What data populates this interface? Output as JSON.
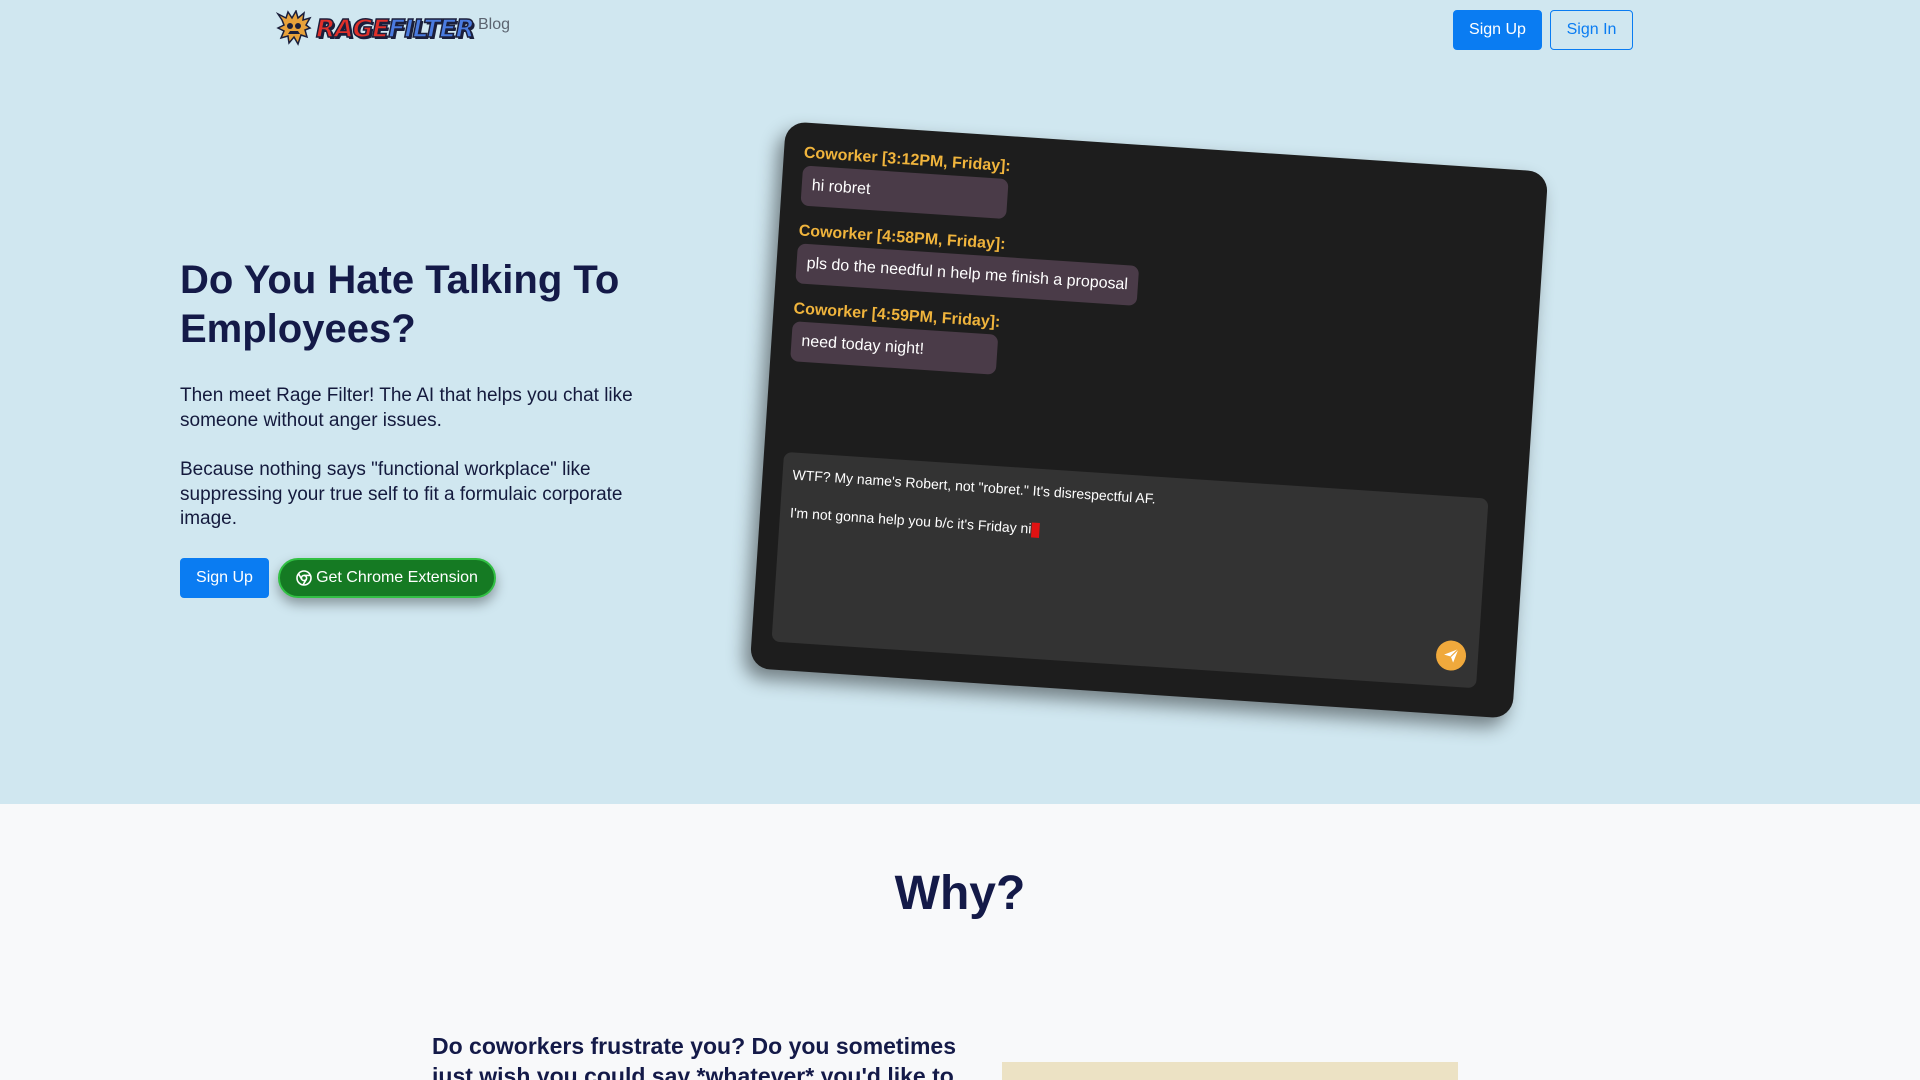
{
  "nav": {
    "brand": {
      "part1": "RAGE",
      "part2": "FILTER"
    },
    "blog_label": "Blog",
    "signup_label": "Sign Up",
    "signin_label": "Sign In"
  },
  "hero": {
    "title": "Do You Hate Talking To Employees?",
    "paragraph1": "Then meet Rage Filter! The AI that helps you chat like someone without anger issues.",
    "paragraph2": "Because nothing says \"functional workplace\" like suppressing your true self to fit a formulaic corporate image.",
    "signup_label": "Sign Up",
    "chrome_label": "Get Chrome Extension"
  },
  "chat": {
    "messages": [
      {
        "sender": "Coworker [3:12PM, Friday]:",
        "text": "hi robret"
      },
      {
        "sender": "Coworker [4:58PM, Friday]:",
        "text": "pls do the needful n help me finish a proposal"
      },
      {
        "sender": "Coworker [4:59PM, Friday]:",
        "text": "need today night!"
      }
    ],
    "reply_line1": "WTF? My name's Robert, not \"robret.\" It's disrespectful AF.",
    "reply_line2": "I'm not gonna help you b/c it's Friday ni",
    "send_icon": "paper-plane-icon"
  },
  "why": {
    "title": "Why?",
    "text": "Do coworkers frustrate you? Do you sometimes just wish you could say *whatever* you'd like to"
  },
  "colors": {
    "hero_bg": "#d0e7f0",
    "primary": "#0a7cf2",
    "chrome_green": "#157a23",
    "sender_orange": "#f0b43c",
    "cursor_red": "#e01212"
  }
}
